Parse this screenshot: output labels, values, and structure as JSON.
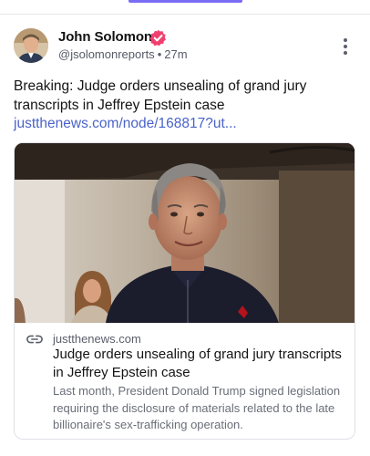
{
  "post": {
    "author": {
      "name": "John Solomon",
      "handle": "@jsolomonreports",
      "separator": "•",
      "time": "27m",
      "verified": true,
      "avatar_icon": "avatar-photo"
    },
    "text": "Breaking: Judge orders unsealing of grand jury transcripts in Jeffrey Epstein case ",
    "link_text": "justthenews.com/node/168817?ut...",
    "more_icon": "more-vertical-icon",
    "card": {
      "image_icon": "article-photo",
      "domain": "justthenews.com",
      "link_icon": "link-icon",
      "title": "Judge orders unsealing of grand jury transcripts in Jeffrey Epstein case",
      "description": "Last month, President Donald Trump signed legislation requiring the disclosure of materials related to the late billionaire's sex-trafficking operation."
    }
  },
  "colors": {
    "accent": "#7b6cf6",
    "link": "#4a63c8",
    "verified": "#f0406f"
  }
}
